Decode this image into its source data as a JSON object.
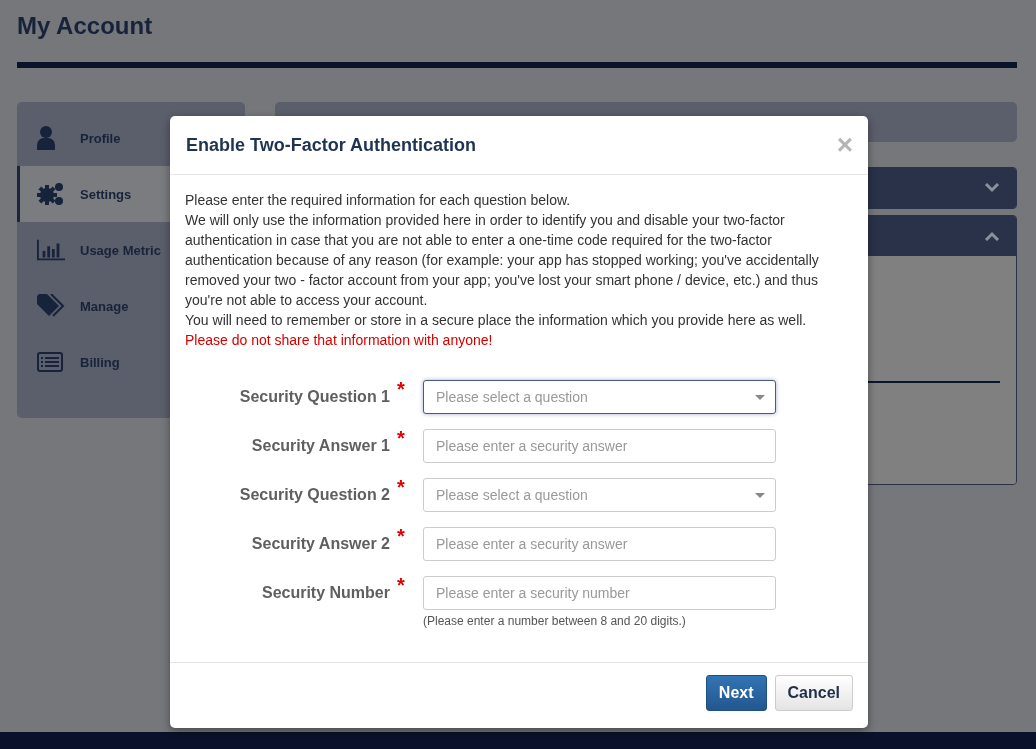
{
  "page": {
    "title": "My Account"
  },
  "sidebar": {
    "items": [
      {
        "label": "Profile",
        "selected": false
      },
      {
        "label": "Settings",
        "selected": true
      },
      {
        "label": "Usage Metric",
        "selected": false
      },
      {
        "label": "Manage",
        "selected": false
      },
      {
        "label": "Billing",
        "selected": false
      }
    ]
  },
  "panels": [
    {
      "expanded": false
    },
    {
      "expanded": true
    }
  ],
  "modal": {
    "title": "Enable Two-Factor Authentication",
    "close": "×",
    "paragraphs": [
      {
        "kind": "normal",
        "text": "Please enter the required information for each question below."
      },
      {
        "kind": "normal",
        "text": "We will only use the information provided here in order to identify you and disable your two-factor authentication in case that you are not able to enter a one-time code required for the two-factor authentication because of any reason (for example: your app has stopped working; you've accidentally removed your two - factor account from your app; you've lost your smart phone / device, etc.) and thus you're not able to access your account."
      },
      {
        "kind": "normal",
        "text": "You will need to remember or store in a secure place the information which you provide here as well."
      },
      {
        "kind": "warning",
        "text": "Please do not share that information with anyone!"
      }
    ],
    "required_mark": "*",
    "fields": [
      {
        "kind": "select",
        "label": "Security Question 1",
        "placeholder": "Please select a question",
        "required": true,
        "focused": true
      },
      {
        "kind": "text",
        "label": "Security Answer 1",
        "placeholder": "Please enter a security answer",
        "required": true,
        "focused": false
      },
      {
        "kind": "select",
        "label": "Security Question 2",
        "placeholder": "Please select a question",
        "required": true,
        "focused": false
      },
      {
        "kind": "text",
        "label": "Security Answer 2",
        "placeholder": "Please enter a security answer",
        "required": true,
        "focused": false
      },
      {
        "kind": "text",
        "label": "Security Number",
        "placeholder": "Please enter a security number",
        "required": true,
        "focused": false,
        "hint": "(Please enter a number between 8 and 20 digits.)"
      }
    ],
    "buttons": [
      {
        "kind": "primary",
        "label": "Next"
      },
      {
        "kind": "default",
        "label": "Cancel"
      }
    ]
  }
}
